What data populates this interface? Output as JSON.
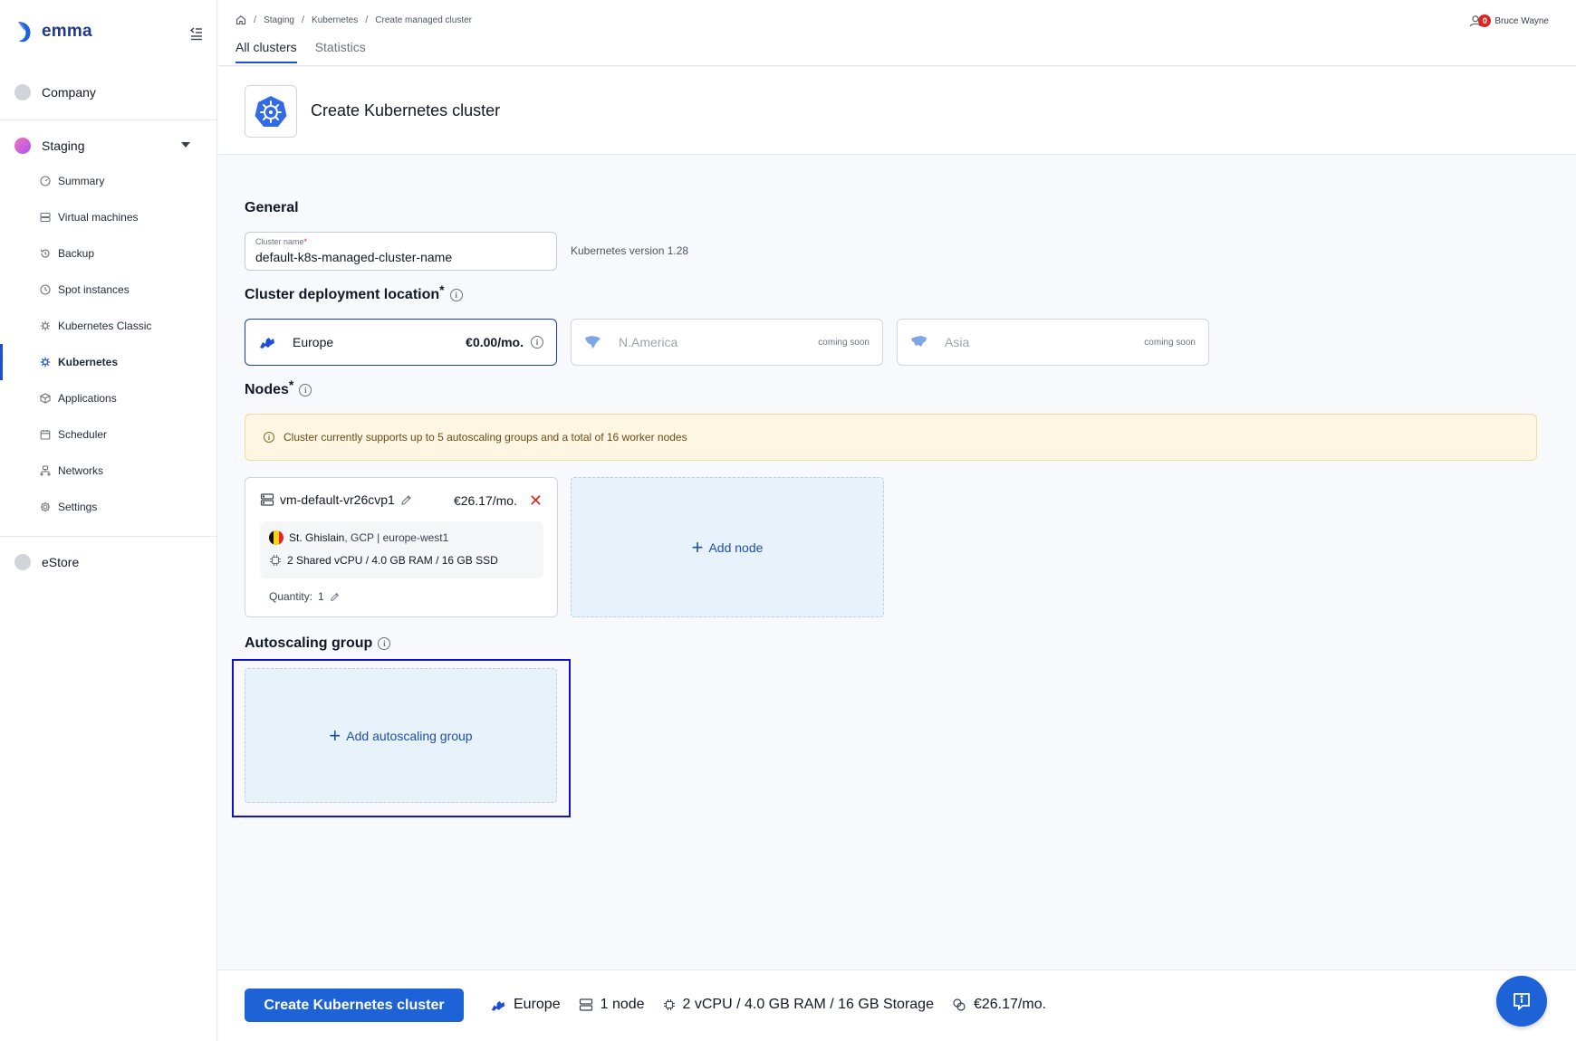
{
  "app": {
    "name": "emma"
  },
  "sidebar": {
    "orgs": {
      "company": "Company",
      "staging": "Staging",
      "estore": "eStore"
    },
    "items": [
      {
        "label": "Summary",
        "icon": "gauge-icon"
      },
      {
        "label": "Virtual machines",
        "icon": "server-icon"
      },
      {
        "label": "Backup",
        "icon": "backup-icon"
      },
      {
        "label": "Spot instances",
        "icon": "clock-icon"
      },
      {
        "label": "Kubernetes Classic",
        "icon": "helm-icon"
      },
      {
        "label": "Kubernetes",
        "icon": "helm-icon",
        "active": true
      },
      {
        "label": "Applications",
        "icon": "cube-icon"
      },
      {
        "label": "Scheduler",
        "icon": "calendar-icon"
      },
      {
        "label": "Networks",
        "icon": "network-icon"
      },
      {
        "label": "Settings",
        "icon": "gear-icon"
      }
    ]
  },
  "header": {
    "breadcrumb": [
      "Staging",
      "Kubernetes",
      "Create managed cluster"
    ],
    "tabs": [
      "All clusters",
      "Statistics"
    ],
    "user": {
      "name": "Bruce Wayne",
      "notifications": "0"
    }
  },
  "page": {
    "title": "Create Kubernetes cluster"
  },
  "general": {
    "title": "General",
    "cluster_name_label": "Cluster name",
    "cluster_name_value": "default-k8s-managed-cluster-name",
    "k8s_version": "Kubernetes version 1.28"
  },
  "location": {
    "title": "Cluster deployment location",
    "options": [
      {
        "name": "Europe",
        "price": "€0.00/mo.",
        "selected": true
      },
      {
        "name": "N.America",
        "status": "coming soon"
      },
      {
        "name": "Asia",
        "status": "coming soon"
      }
    ]
  },
  "nodes": {
    "title": "Nodes",
    "alert": "Cluster currently supports up to 5 autoscaling groups and a total of 16 worker nodes",
    "items": [
      {
        "name": "vm-default-vr26cvp1",
        "price": "€26.17/mo.",
        "location_city": "St. Ghislain",
        "location_rest": ", GCP | europe-west1",
        "specs": "2 Shared vCPU / 4.0 GB RAM / 16 GB SSD",
        "quantity_label": "Quantity:",
        "quantity": "1"
      }
    ],
    "add_label": "Add node"
  },
  "autoscaling": {
    "title": "Autoscaling group",
    "add_label": "Add autoscaling group"
  },
  "footer": {
    "create_label": "Create Kubernetes cluster",
    "region": "Europe",
    "nodes": "1 node",
    "resources": "2 vCPU / 4.0 GB RAM / 16 GB Storage",
    "cost": "€26.17/mo."
  },
  "colors": {
    "primary": "#1d62d6",
    "alert_bg": "#fdf6e3",
    "danger": "#dc2626",
    "highlight": "#1010d0"
  }
}
